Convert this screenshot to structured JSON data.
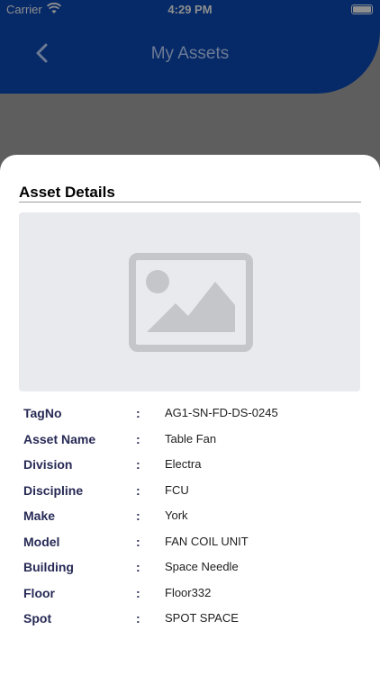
{
  "status_bar": {
    "carrier": "Carrier",
    "time": "4:29 PM"
  },
  "nav": {
    "title": "My Assets",
    "back_icon": "chevron-left-icon"
  },
  "sheet": {
    "title": "Asset Details",
    "image_icon": "image-placeholder-icon",
    "details": [
      {
        "label": "TagNo",
        "value": "AG1-SN-FD-DS-0245"
      },
      {
        "label": "Asset Name",
        "value": "Table Fan"
      },
      {
        "label": "Division",
        "value": "Electra"
      },
      {
        "label": "Discipline",
        "value": "FCU"
      },
      {
        "label": "Make",
        "value": "York"
      },
      {
        "label": "Model",
        "value": "FAN COIL UNIT"
      },
      {
        "label": "Building",
        "value": "Space Needle"
      },
      {
        "label": "Floor",
        "value": "Floor332"
      },
      {
        "label": "Spot",
        "value": "SPOT SPACE"
      }
    ],
    "separator": ":"
  },
  "colors": {
    "header": "#062a68",
    "overlay": "#5e5e5e",
    "label": "#272a55",
    "placeholder_bg": "#e8eaee",
    "placeholder_icon": "#c4c6ca"
  }
}
